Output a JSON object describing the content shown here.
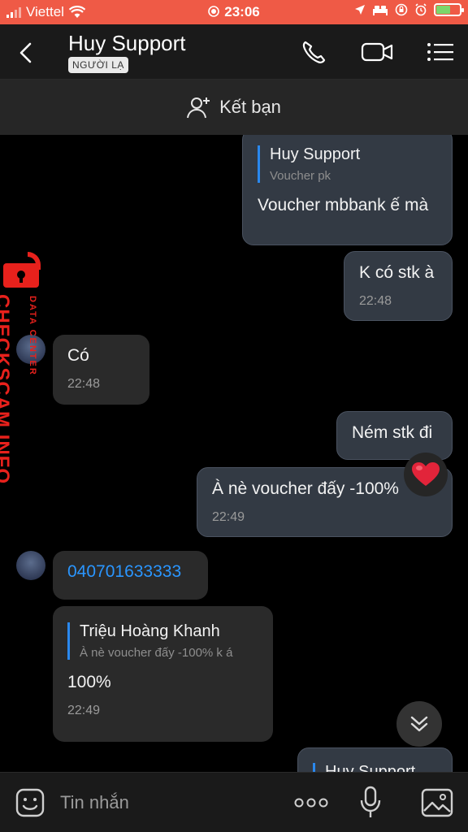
{
  "status": {
    "carrier": "Viettel",
    "time": "23:06"
  },
  "header": {
    "title": "Huy Support",
    "badge": "NGƯỜI LẠ"
  },
  "add_friend": {
    "label": "Kết bạn"
  },
  "messages": [
    {
      "quote_name": "Huy Support",
      "quote_text": "Voucher pk",
      "text": "Voucher mbbank ế mà"
    },
    {
      "text": "K có stk à",
      "time": "22:48"
    },
    {
      "text": "Có",
      "time": "22:48"
    },
    {
      "text": "Ném stk đi"
    },
    {
      "text": "À nè voucher đấy -100%",
      "time": "22:49",
      "reaction": "heart"
    },
    {
      "text": "040701633333"
    },
    {
      "quote_name": "Triệu Hoàng Khanh",
      "quote_text": "À nè voucher đấy -100% k á",
      "text": "100%",
      "time": "22:49"
    },
    {
      "quote_name": "Huy Support"
    }
  ],
  "watermark": {
    "brand": "CHECKSCAM.INFO",
    "sub": "DATA CENTER"
  },
  "composer": {
    "placeholder": "Tin nhắn"
  },
  "colors": {
    "statusbar": "#ef5a46",
    "link": "#2a96ff",
    "quote_bar": "#2a88ee"
  }
}
